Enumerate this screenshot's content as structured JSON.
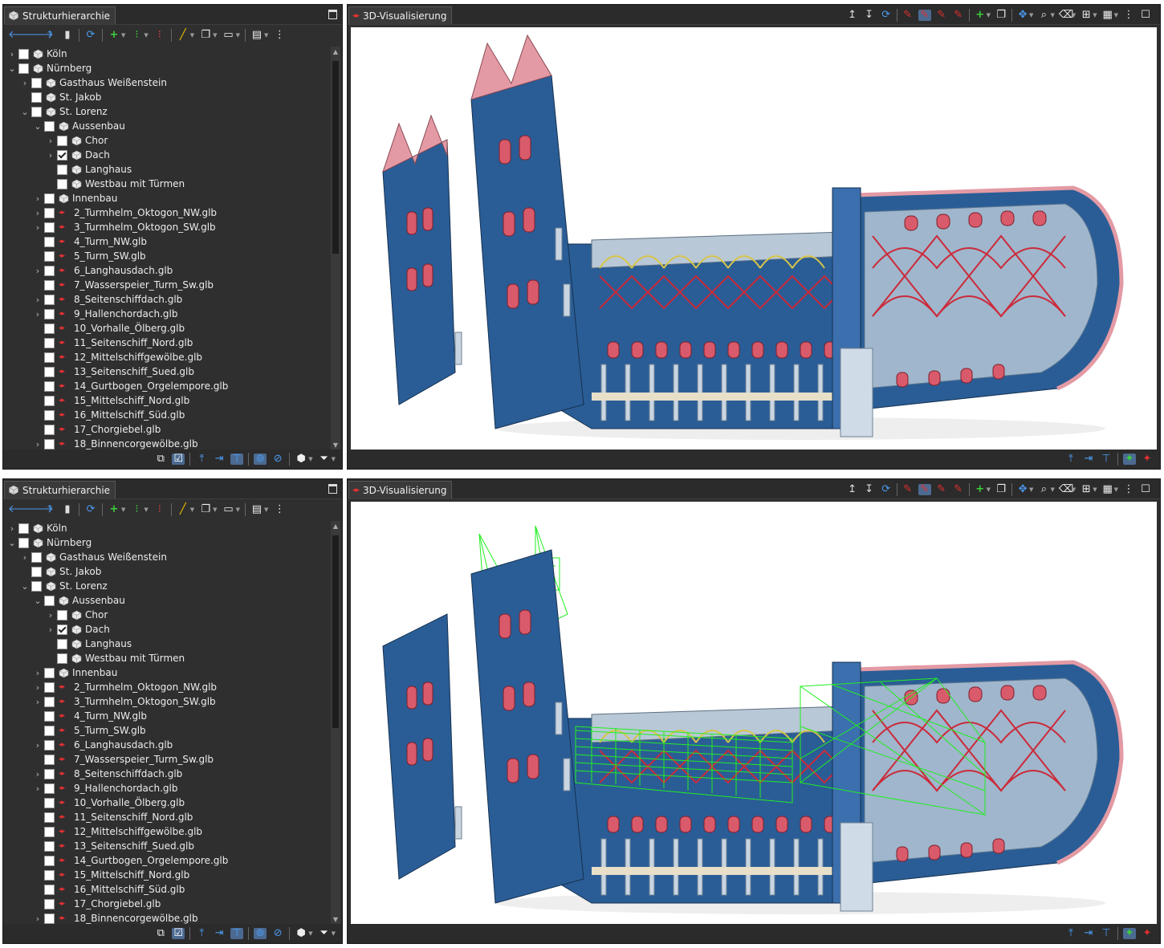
{
  "panels": [
    {
      "id": "top",
      "left_tab": "Strukturhierarchie",
      "right_tab": "3D-Visualisierung",
      "roof_wireframe_visible": false
    },
    {
      "id": "bottom",
      "left_tab": "Strukturhierarchie",
      "right_tab": "3D-Visualisierung",
      "roof_wireframe_visible": true
    }
  ],
  "tree": [
    {
      "label": "Köln",
      "depth": 0,
      "expander": "closed",
      "checked": false,
      "icon": "cube-icon"
    },
    {
      "label": "Nürnberg",
      "depth": 0,
      "expander": "open",
      "checked": false,
      "icon": "cube-icon"
    },
    {
      "label": "Gasthaus Weißenstein",
      "depth": 1,
      "expander": "closed",
      "checked": false,
      "icon": "cube-icon"
    },
    {
      "label": "St. Jakob",
      "depth": 1,
      "expander": "none",
      "checked": false,
      "icon": "cube-icon"
    },
    {
      "label": "St. Lorenz",
      "depth": 1,
      "expander": "open",
      "checked": false,
      "icon": "cube-icon"
    },
    {
      "label": "Aussenbau",
      "depth": 2,
      "expander": "open",
      "checked": false,
      "icon": "cube-icon"
    },
    {
      "label": "Chor",
      "depth": 3,
      "expander": "closed",
      "checked": false,
      "icon": "cube-icon"
    },
    {
      "label": "Dach",
      "depth": 3,
      "expander": "closed",
      "checked": true,
      "icon": "cube-icon"
    },
    {
      "label": "Langhaus",
      "depth": 3,
      "expander": "none",
      "checked": false,
      "icon": "cube-icon"
    },
    {
      "label": "Westbau mit Türmen",
      "depth": 3,
      "expander": "none",
      "checked": false,
      "icon": "cube-icon"
    },
    {
      "label": "Innenbau",
      "depth": 2,
      "expander": "closed",
      "checked": false,
      "icon": "cube-icon"
    },
    {
      "label": "2_Turmhelm_Oktogon_NW.glb",
      "depth": 2,
      "expander": "closed",
      "checked": false,
      "icon": "file-icon"
    },
    {
      "label": "3_Turmhelm_Oktogon_SW.glb",
      "depth": 2,
      "expander": "closed",
      "checked": false,
      "icon": "file-icon"
    },
    {
      "label": "4_Turm_NW.glb",
      "depth": 2,
      "expander": "none",
      "checked": false,
      "icon": "file-icon"
    },
    {
      "label": "5_Turm_SW.glb",
      "depth": 2,
      "expander": "none",
      "checked": false,
      "icon": "file-icon"
    },
    {
      "label": "6_Langhausdach.glb",
      "depth": 2,
      "expander": "closed",
      "checked": false,
      "icon": "file-icon"
    },
    {
      "label": "7_Wasserspeier_Turm_Sw.glb",
      "depth": 2,
      "expander": "none",
      "checked": false,
      "icon": "file-icon"
    },
    {
      "label": "8_Seitenschiffdach.glb",
      "depth": 2,
      "expander": "closed",
      "checked": false,
      "icon": "file-icon"
    },
    {
      "label": "9_Hallenchordach.glb",
      "depth": 2,
      "expander": "closed",
      "checked": false,
      "icon": "file-icon"
    },
    {
      "label": "10_Vorhalle_Ölberg.glb",
      "depth": 2,
      "expander": "none",
      "checked": false,
      "icon": "file-icon"
    },
    {
      "label": "11_Seitenschiff_Nord.glb",
      "depth": 2,
      "expander": "none",
      "checked": false,
      "icon": "file-icon"
    },
    {
      "label": "12_Mittelschiffgewölbe.glb",
      "depth": 2,
      "expander": "none",
      "checked": false,
      "icon": "file-icon"
    },
    {
      "label": "13_Seitenschiff_Sued.glb",
      "depth": 2,
      "expander": "none",
      "checked": false,
      "icon": "file-icon"
    },
    {
      "label": "14_Gurtbogen_Orgelempore.glb",
      "depth": 2,
      "expander": "none",
      "checked": false,
      "icon": "file-icon"
    },
    {
      "label": "15_Mittelschiff_Nord.glb",
      "depth": 2,
      "expander": "none",
      "checked": false,
      "icon": "file-icon"
    },
    {
      "label": "16_Mittelschiff_Süd.glb",
      "depth": 2,
      "expander": "none",
      "checked": false,
      "icon": "file-icon"
    },
    {
      "label": "17_Chorgiebel.glb",
      "depth": 2,
      "expander": "none",
      "checked": false,
      "icon": "file-icon"
    },
    {
      "label": "18_Binnencorgewölbe.glb",
      "depth": 2,
      "expander": "closed",
      "checked": false,
      "icon": "file-icon"
    }
  ],
  "tree_toolbar_icons": [
    "back-arrow-icon",
    "forward-arrow-icon",
    "up-arrow-icon",
    "bookmark-icon",
    "refresh-icon",
    "add-icon",
    "move-icon",
    "remove-icon",
    "edit-pen-icon",
    "copy-icon",
    "view-icon",
    "collapse-icon",
    "menu-icon"
  ],
  "viewport_toolbar_icons": [
    "move-up-icon",
    "move-down-icon",
    "refresh-icon",
    "pin-icon",
    "pin-remove-icon",
    "pin-add-icon",
    "pin-edit-icon",
    "add-icon",
    "copy-icon",
    "pan-icon",
    "zoom-icon",
    "eraser-icon",
    "grid-icon",
    "display-icon",
    "menu-icon",
    "maximize-icon"
  ],
  "colors": {
    "panel_bg": "#2f2f2f",
    "wall_blue": "#2a5d96",
    "roof_pink": "#e39aa4",
    "column_light": "#b9c8d6",
    "wireframe_green": "#22ee22",
    "vault_red": "#cc2a3a",
    "accent_blue": "#4c8fe0"
  }
}
